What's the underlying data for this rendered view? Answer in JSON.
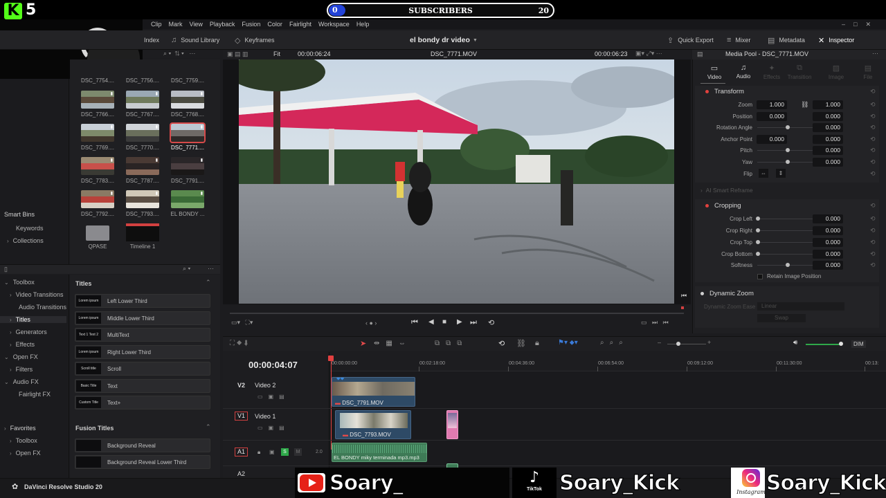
{
  "overlay": {
    "kick_logo": "K",
    "kick_count": "5",
    "sub_bar": {
      "left_value": "0",
      "label": "SUBSCRIBERS",
      "right_value": "20"
    }
  },
  "menu": [
    "Clip",
    "Mark",
    "View",
    "Playback",
    "Fusion",
    "Color",
    "Fairlight",
    "Workspace",
    "Help"
  ],
  "toolbar": {
    "index": "Index",
    "sound_library": "Sound Library",
    "keyframes": "Keyframes",
    "project_title": "el bondy dr video",
    "quick_export": "Quick Export",
    "mixer": "Mixer",
    "metadata": "Metadata",
    "inspector": "Inspector"
  },
  "viewer_bar": {
    "fit": "Fit",
    "timecode_left": "00:00:06:24",
    "clip_name": "DSC_7771.MOV",
    "timecode_right": "00:00:06:23"
  },
  "media_pool": {
    "clips": [
      {
        "label": "DSC_7766....",
        "colors": [
          "#7d8a6e",
          "#5a4a3a",
          "#a8b2b8"
        ]
      },
      {
        "label": "DSC_7767....",
        "colors": [
          "#9aa8b4",
          "#6f7a5c",
          "#c8ccd0"
        ]
      },
      {
        "label": "DSC_7768....",
        "colors": [
          "#b8bcc4",
          "#4a4a40",
          "#dadcdf"
        ]
      },
      {
        "label": "DSC_7769....",
        "colors": [
          "#c8cfd6",
          "#7e8a6a",
          "#40362c"
        ]
      },
      {
        "label": "DSC_7770....",
        "colors": [
          "#d0d4d8",
          "#6a6f5c",
          "#3a3a3a"
        ]
      },
      {
        "label": "DSC_7771....",
        "colors": [
          "#bcc8d2",
          "#6f6a66",
          "#2e2a28"
        ]
      },
      {
        "label": "DSC_7783....",
        "colors": [
          "#9a8a72",
          "#c8504a",
          "#3a3a34"
        ]
      },
      {
        "label": "DSC_7787....",
        "colors": [
          "#4a3a34",
          "#2a2424",
          "#8a6a5a"
        ]
      },
      {
        "label": "DSC_7791....",
        "colors": [
          "#2a2628",
          "#4a3e40",
          "#1a1818"
        ]
      },
      {
        "label": "DSC_7792....",
        "colors": [
          "#8a7a64",
          "#b8423a",
          "#d8d0c4"
        ]
      },
      {
        "label": "DSC_7793....",
        "colors": [
          "#d0c8b8",
          "#5a4e44",
          "#e8e4dc"
        ]
      },
      {
        "label": "EL BONDY ...",
        "colors": [
          "#5a8a4e",
          "#3a6a36",
          "#7aa86a"
        ]
      }
    ],
    "folder_label": "QPASE",
    "timeline_label": "Timeline 1",
    "top_row_labels": [
      "DSC_7754....",
      "DSC_7756....",
      "DSC_7759...."
    ]
  },
  "bins": {
    "smart_bins": "Smart Bins",
    "keywords": "Keywords",
    "collections": "Collections"
  },
  "effects_tree": [
    {
      "label": "Toolbox",
      "level": 0
    },
    {
      "label": "Video Transitions",
      "level": 1
    },
    {
      "label": "Audio Transitions",
      "level": 1
    },
    {
      "label": "Titles",
      "level": 1,
      "active": true
    },
    {
      "label": "Generators",
      "level": 1
    },
    {
      "label": "Effects",
      "level": 1
    },
    {
      "label": "Open FX",
      "level": 0
    },
    {
      "label": "Filters",
      "level": 1
    },
    {
      "label": "Audio FX",
      "level": 0
    },
    {
      "label": "Fairlight FX",
      "level": 1
    }
  ],
  "favorites": {
    "header": "Favorites",
    "items": [
      "Toolbox",
      "Open FX"
    ]
  },
  "titles": {
    "header": "Titles",
    "items": [
      {
        "icon": "Lorem ipsum",
        "label": "Left Lower Third"
      },
      {
        "icon": "Lorem ipsum",
        "label": "Middle Lower Third"
      },
      {
        "icon": "Text 1 Text 2",
        "label": "MultiText"
      },
      {
        "icon": "Lorem ipsum",
        "label": "Right Lower Third"
      },
      {
        "icon": "Scroll title",
        "label": "Scroll"
      },
      {
        "icon": "Basic Title",
        "label": "Text"
      },
      {
        "icon": "Custom Title",
        "label": "Text+"
      }
    ],
    "fusion_header": "Fusion Titles",
    "fusion_items": [
      {
        "label": "Background Reveal"
      },
      {
        "label": "Background Reveal Lower Third"
      }
    ]
  },
  "inspector": {
    "header": "Media Pool - DSC_7771.MOV",
    "tabs": [
      "Video",
      "Audio",
      "Effects",
      "Transition",
      "Image",
      "File"
    ],
    "transform": {
      "title": "Transform",
      "zoom": {
        "label": "Zoom",
        "x": "1.000",
        "y": "1.000"
      },
      "position": {
        "label": "Position",
        "x": "0.000",
        "y": "0.000"
      },
      "rotation": {
        "label": "Rotation Angle",
        "value": "0.000"
      },
      "anchor": {
        "label": "Anchor Point",
        "x": "0.000",
        "y": "0.000"
      },
      "pitch": {
        "label": "Pitch",
        "value": "0.000"
      },
      "yaw": {
        "label": "Yaw",
        "value": "0.000"
      },
      "flip": {
        "label": "Flip"
      }
    },
    "ai_reframe": "AI Smart Reframe",
    "cropping": {
      "title": "Cropping",
      "left": {
        "label": "Crop Left",
        "value": "0.000"
      },
      "right": {
        "label": "Crop Right",
        "value": "0.000"
      },
      "top": {
        "label": "Crop Top",
        "value": "0.000"
      },
      "bottom": {
        "label": "Crop Bottom",
        "value": "0.000"
      },
      "softness": {
        "label": "Softness",
        "value": "0.000"
      },
      "retain": "Retain Image Position"
    },
    "dynamic_zoom": {
      "title": "Dynamic Zoom",
      "ease_label": "Dynamic Zoom Ease",
      "ease_value": "Linear",
      "swap": "Swap"
    }
  },
  "timeline": {
    "timecode": "00:00:04:07",
    "ruler": [
      "00:00:00:00",
      "00:02:18:00",
      "00:04:36:00",
      "00:06:54:00",
      "00:09:12:00",
      "00:11:30:00",
      "00:13:"
    ],
    "tracks": {
      "v2": {
        "id": "V2",
        "name": "Video 2",
        "clip": "DSC_7791.MOV"
      },
      "v1": {
        "id": "V1",
        "name": "Video 1",
        "clip": "DSC_7793.MOV"
      },
      "a1": {
        "id": "A1",
        "clip": "EL BONDY miky  terminada mp3.mp3",
        "channels": "2.0",
        "solo": "S",
        "mute": "M"
      },
      "a2": {
        "id": "A2"
      }
    },
    "dim": "DIM"
  },
  "footer": {
    "app_name": "DaVinci Resolve Studio 20"
  },
  "socials": [
    {
      "platform": "youtube",
      "handle": "Soary_"
    },
    {
      "platform": "tiktok",
      "caption": "TikTok",
      "handle": "Soary_Kick"
    },
    {
      "platform": "instagram",
      "caption": "Instagram",
      "handle": "Soary_Kick"
    }
  ]
}
